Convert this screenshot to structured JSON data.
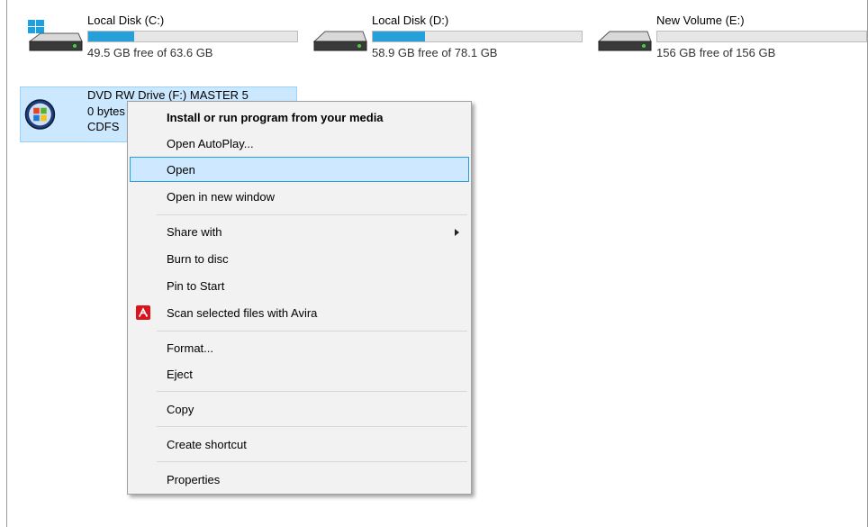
{
  "drives": [
    {
      "name": "Local Disk (C:)",
      "free": "49.5 GB free of 63.6 GB",
      "fill": 0.22,
      "icon": "windows-drive-icon"
    },
    {
      "name": "Local Disk (D:)",
      "free": "58.9 GB free of 78.1 GB",
      "fill": 0.25,
      "icon": "hard-drive-icon"
    },
    {
      "name": "New Volume (E:)",
      "free": "156 GB free of 156 GB",
      "fill": 0.0,
      "icon": "hard-drive-icon"
    }
  ],
  "dvd": {
    "name": "DVD RW Drive (F:) MASTER 5",
    "line2": "0 bytes",
    "line3": "CDFS",
    "icon": "dvd-disc-icon"
  },
  "menu": {
    "items": [
      {
        "label": "Install or run program from your media",
        "bold": true
      },
      {
        "label": "Open AutoPlay..."
      },
      {
        "label": "Open",
        "highlighted": true
      },
      {
        "label": "Open in new window"
      },
      {
        "label": "Share with",
        "submenu": true
      },
      {
        "label": "Burn to disc"
      },
      {
        "label": "Pin to Start"
      },
      {
        "label": "Scan selected files with Avira",
        "icon": "avira-icon"
      },
      {
        "label": "Format..."
      },
      {
        "label": "Eject"
      },
      {
        "label": "Copy"
      },
      {
        "label": "Create shortcut"
      },
      {
        "label": "Properties"
      }
    ]
  },
  "colors": {
    "accent": "#26a0da",
    "selection": "#cce8ff",
    "avira": "#d8141d"
  }
}
